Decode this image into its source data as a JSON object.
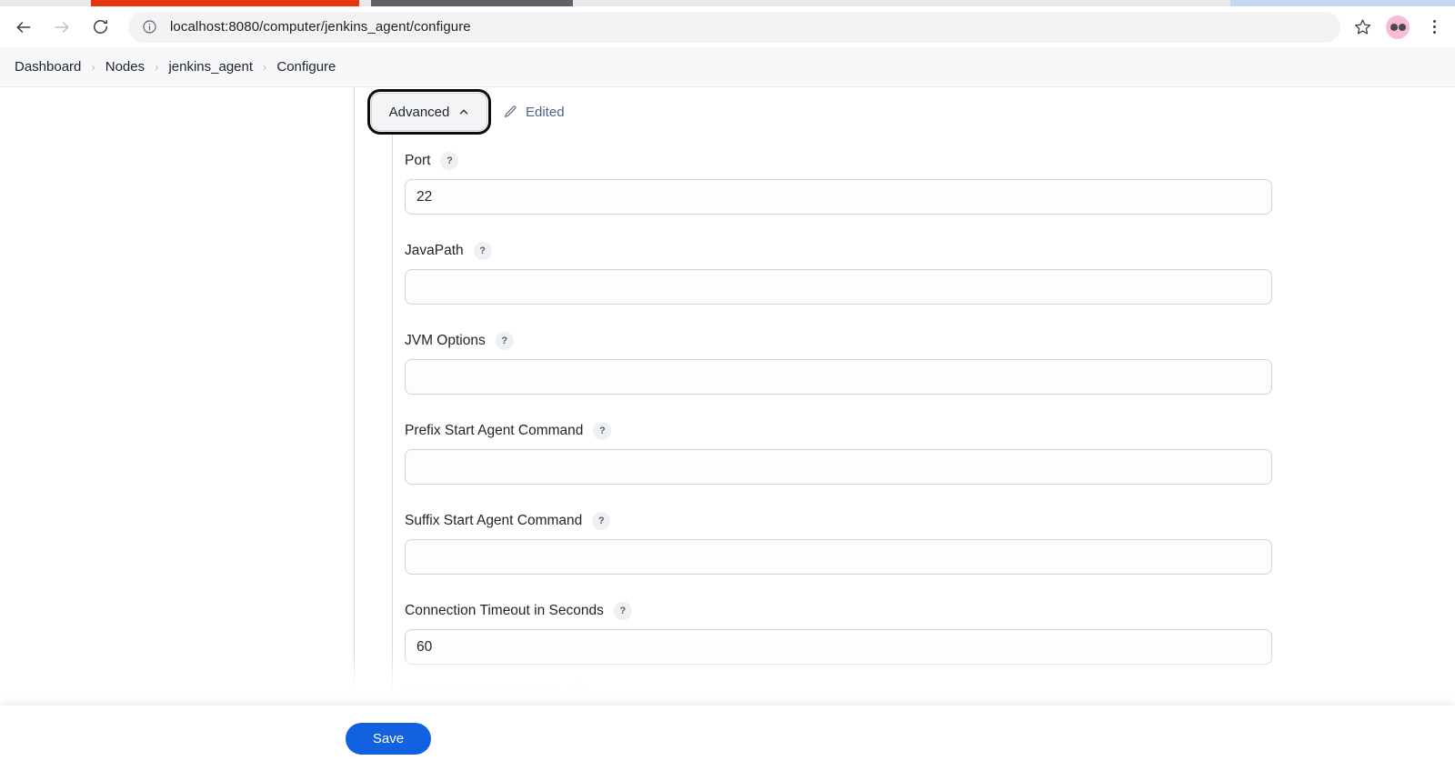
{
  "browser": {
    "url": "localhost:8080/computer/jenkins_agent/configure",
    "back_icon": "back-arrow-icon",
    "forward_icon": "forward-arrow-icon",
    "reload_icon": "reload-icon",
    "info_icon": "site-info-icon",
    "star_icon": "bookmark-star-icon",
    "avatar_icon": "profile-avatar-icon",
    "menu_icon": "chrome-menu-icon",
    "tab_colors": {
      "active_tab": "#e8340c",
      "inactive_tab": "#5f6368",
      "right_tab": "#c7d6f0"
    }
  },
  "breadcrumb": {
    "separator": "›",
    "items": [
      {
        "label": "Dashboard"
      },
      {
        "label": "Nodes"
      },
      {
        "label": "jenkins_agent"
      },
      {
        "label": "Configure"
      }
    ]
  },
  "toolbar": {
    "advanced_label": "Advanced",
    "advanced_chevron": "chevron-up-icon",
    "edited_label": "Edited",
    "edited_icon": "pencil-icon",
    "edited_color": "#4e6186"
  },
  "form": {
    "help_glyph": "?",
    "fields": [
      {
        "label": "Port",
        "value": "22",
        "placeholder": ""
      },
      {
        "label": "JavaPath",
        "value": "",
        "placeholder": ""
      },
      {
        "label": "JVM Options",
        "value": "",
        "placeholder": ""
      },
      {
        "label": "Prefix Start Agent Command",
        "value": "",
        "placeholder": ""
      },
      {
        "label": "Suffix Start Agent Command",
        "value": "",
        "placeholder": ""
      },
      {
        "label": "Connection Timeout in Seconds",
        "value": "60",
        "placeholder": ""
      }
    ]
  },
  "footer": {
    "save_label": "Save",
    "save_color": "#1161e0"
  }
}
